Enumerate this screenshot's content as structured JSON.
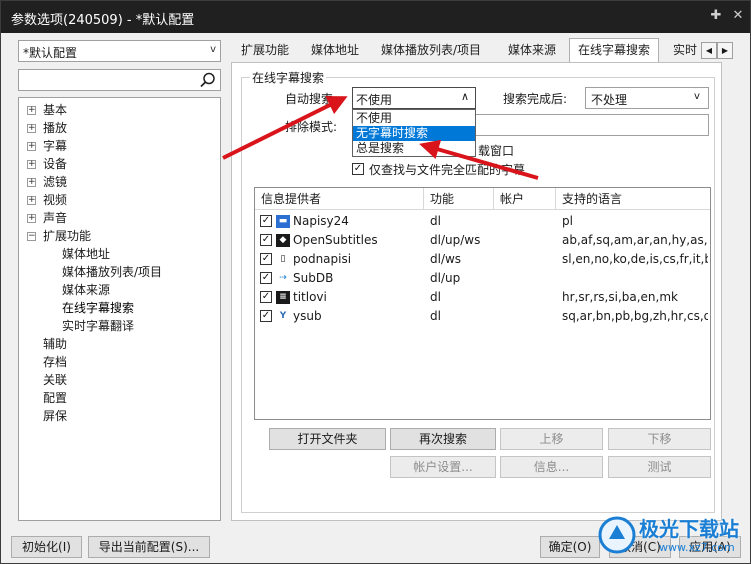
{
  "window": {
    "title": "参数选项(240509) - *默认配置"
  },
  "profile_combo": {
    "value": "*默认配置"
  },
  "search": {
    "placeholder": ""
  },
  "tree": [
    {
      "label": "基本",
      "expandable": true
    },
    {
      "label": "播放",
      "expandable": true
    },
    {
      "label": "字幕",
      "expandable": true
    },
    {
      "label": "设备",
      "expandable": true
    },
    {
      "label": "滤镜",
      "expandable": true
    },
    {
      "label": "视频",
      "expandable": true
    },
    {
      "label": "声音",
      "expandable": true
    },
    {
      "label": "扩展功能",
      "expandable": true,
      "expanded": true
    },
    {
      "label": "媒体地址",
      "child": true
    },
    {
      "label": "媒体播放列表/项目",
      "child": true
    },
    {
      "label": "媒体来源",
      "child": true
    },
    {
      "label": "在线字幕搜索",
      "child": true,
      "selected": true
    },
    {
      "label": "实时字幕翻译",
      "child": true
    },
    {
      "label": "辅助"
    },
    {
      "label": "存档"
    },
    {
      "label": "关联"
    },
    {
      "label": "配置"
    },
    {
      "label": "屏保"
    }
  ],
  "tabs": [
    "扩展功能",
    "媒体地址",
    "媒体播放列表/项目",
    "媒体来源",
    "在线字幕搜索",
    "实时"
  ],
  "group_label": "在线字幕搜索",
  "auto_search": {
    "label": "自动搜索:",
    "value": "不使用"
  },
  "after_search": {
    "label": "搜索完成后:",
    "value": "不处理"
  },
  "exclude": {
    "label": "排除模式:"
  },
  "dropdown_options": [
    "不使用",
    "无字幕时搜索",
    "总是搜索"
  ],
  "checkbox_window": {
    "label": "载窗口",
    "checked": true
  },
  "checkbox_exact": {
    "label": "仅查找与文件完全匹配的字幕",
    "checked": true
  },
  "table": {
    "columns": [
      "信息提供者",
      "功能",
      "帐户",
      "支持的语言"
    ],
    "rows": [
      {
        "provider": "Napisy24",
        "func": "dl",
        "account": "",
        "langs": "pl",
        "icon": "napisy-icon"
      },
      {
        "provider": "OpenSubtitles",
        "func": "dl/up/ws",
        "account": "",
        "langs": "ab,af,sq,am,ar,an,hy,as,a",
        "icon": "opensubtitles-icon"
      },
      {
        "provider": "podnapisi",
        "func": "dl/ws",
        "account": "",
        "langs": "sl,en,no,ko,de,is,cs,fr,it,b",
        "icon": "podnapisi-icon"
      },
      {
        "provider": "SubDB",
        "func": "dl/up",
        "account": "",
        "langs": "",
        "icon": "subdb-icon"
      },
      {
        "provider": "titlovi",
        "func": "dl",
        "account": "",
        "langs": "hr,sr,rs,si,ba,en,mk",
        "icon": "titlovi-icon"
      },
      {
        "provider": "ysub",
        "func": "dl",
        "account": "",
        "langs": "sq,ar,bn,pb,bg,zh,hr,cs,d",
        "icon": "ysub-icon"
      }
    ]
  },
  "buttons": {
    "open_folder": "打开文件夹",
    "search_again": "再次搜索",
    "move_up": "上移",
    "move_down": "下移",
    "account_settings": "帐户设置...",
    "info": "信息...",
    "test": "测试",
    "init": "初始化(I)",
    "export": "导出当前配置(S)...",
    "ok": "确定(O)",
    "cancel": "取消(C)",
    "apply": "应用(A)"
  },
  "watermark": {
    "text": "极光下载站",
    "url": "www.xz7.com"
  },
  "colors": {
    "accent": "#0078d7",
    "arrow": "#d9141b",
    "titlebar": "#202020"
  }
}
